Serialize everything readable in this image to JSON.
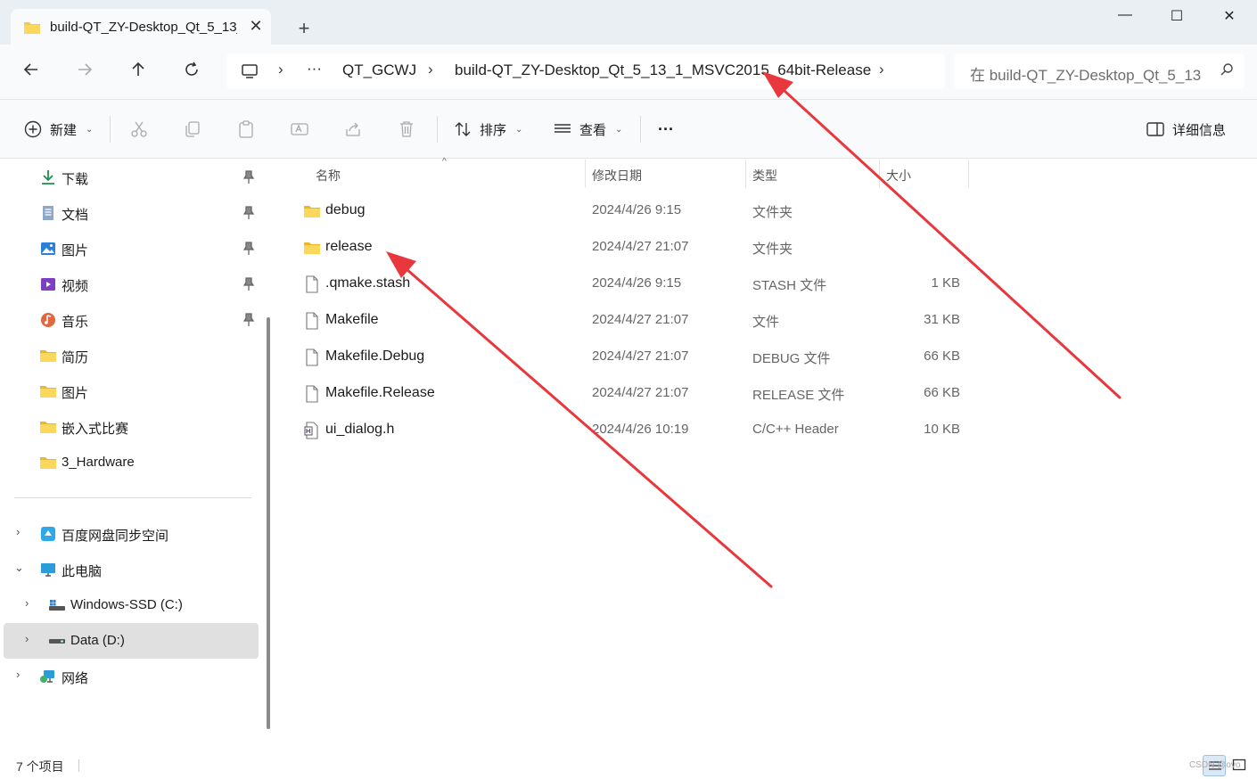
{
  "window": {
    "tab_title": "build-QT_ZY-Desktop_Qt_5_13_",
    "new_tab_label": "+",
    "minimize_label": "—",
    "maximize_label": "☐",
    "close_label": "✕"
  },
  "address": {
    "ellipsis": "···",
    "breadcrumbs": [
      "QT_GCWJ",
      "build-QT_ZY-Desktop_Qt_5_13_1_MSVC2015_64bit-Release"
    ],
    "search_placeholder": "在 build-QT_ZY-Desktop_Qt_5_13"
  },
  "commandbar": {
    "new_label": "新建",
    "sort_label": "排序",
    "view_label": "查看",
    "more_label": "···",
    "details_label": "详细信息"
  },
  "sidebar": {
    "quick_access": [
      {
        "label": "下载",
        "icon": "download-icon",
        "pinned": true
      },
      {
        "label": "文档",
        "icon": "documents-icon",
        "pinned": true
      },
      {
        "label": "图片",
        "icon": "pictures-icon",
        "pinned": true
      },
      {
        "label": "视频",
        "icon": "videos-icon",
        "pinned": true
      },
      {
        "label": "音乐",
        "icon": "music-icon",
        "pinned": true
      },
      {
        "label": "简历",
        "icon": "folder-icon",
        "pinned": false
      },
      {
        "label": "图片",
        "icon": "folder-icon",
        "pinned": false
      },
      {
        "label": "嵌入式比赛",
        "icon": "folder-icon",
        "pinned": false
      },
      {
        "label": "3_Hardware",
        "icon": "folder-icon",
        "pinned": false
      }
    ],
    "tree": [
      {
        "label": "百度网盘同步空间",
        "icon": "baidu-netdisk-icon",
        "expanded": false
      },
      {
        "label": "此电脑",
        "icon": "this-pc-icon",
        "expanded": true
      },
      {
        "label": "Windows-SSD (C:)",
        "icon": "drive-icon",
        "expanded": false
      },
      {
        "label": "Data (D:)",
        "icon": "drive-icon",
        "expanded": false,
        "selected": true
      },
      {
        "label": "网络",
        "icon": "network-icon",
        "expanded": false
      }
    ]
  },
  "filelist": {
    "columns": {
      "name": "名称",
      "date": "修改日期",
      "type": "类型",
      "size": "大小"
    },
    "rows": [
      {
        "name": "debug",
        "date": "2024/4/26 9:15",
        "type": "文件夹",
        "size": "",
        "icon": "folder-icon"
      },
      {
        "name": "release",
        "date": "2024/4/27 21:07",
        "type": "文件夹",
        "size": "",
        "icon": "folder-icon"
      },
      {
        "name": ".qmake.stash",
        "date": "2024/4/26 9:15",
        "type": "STASH 文件",
        "size": "1 KB",
        "icon": "file-icon"
      },
      {
        "name": "Makefile",
        "date": "2024/4/27 21:07",
        "type": "文件",
        "size": "31 KB",
        "icon": "file-icon"
      },
      {
        "name": "Makefile.Debug",
        "date": "2024/4/27 21:07",
        "type": "DEBUG 文件",
        "size": "66 KB",
        "icon": "file-icon"
      },
      {
        "name": "Makefile.Release",
        "date": "2024/4/27 21:07",
        "type": "RELEASE 文件",
        "size": "66 KB",
        "icon": "file-icon"
      },
      {
        "name": "ui_dialog.h",
        "date": "2024/4/26 10:19",
        "type": "C/C++ Header",
        "size": "10 KB",
        "icon": "header-file-icon"
      }
    ]
  },
  "statusbar": {
    "item_count": "7 个项目",
    "watermark": "CSDN @ovo"
  },
  "colors": {
    "annotation_arrow": "#e8383d",
    "folder": "#f7c948",
    "accent": "#0067c0"
  }
}
